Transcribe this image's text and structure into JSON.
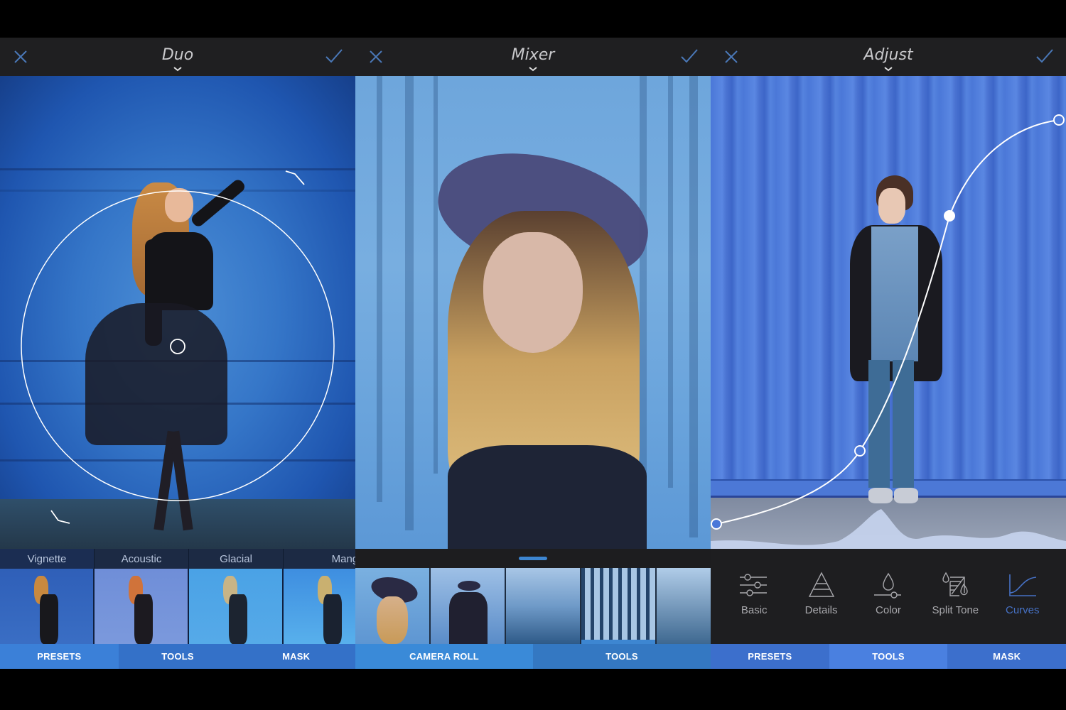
{
  "panels": [
    {
      "id": "duo",
      "header": {
        "title": "Duo",
        "close_icon": "close-icon",
        "confirm_icon": "checkmark-icon",
        "menu_icon": "chevron-down-icon"
      },
      "presets": [
        {
          "label": "Vignette"
        },
        {
          "label": "Acoustic"
        },
        {
          "label": "Glacial"
        },
        {
          "label": "Mangata"
        }
      ],
      "tabs": [
        {
          "label": "PRESETS",
          "active": true
        },
        {
          "label": "TOOLS",
          "active": false
        },
        {
          "label": "MASK",
          "active": false
        }
      ],
      "colors": {
        "tab_active": "#3b80d8",
        "tab_inactive": "#3471c8"
      }
    },
    {
      "id": "mixer",
      "header": {
        "title": "Mixer",
        "close_icon": "close-icon",
        "confirm_icon": "checkmark-icon",
        "menu_icon": "chevron-down-icon"
      },
      "thumbnails": [
        {
          "name": "woman-with-hat-portrait",
          "selected": false
        },
        {
          "name": "woman-with-hat-full",
          "selected": false
        },
        {
          "name": "misty-mountain-forest",
          "selected": false
        },
        {
          "name": "forest-trunks",
          "selected": true
        },
        {
          "name": "snowy-pines",
          "selected": false
        }
      ],
      "tabs": [
        {
          "label": "CAMERA ROLL",
          "active": true
        },
        {
          "label": "TOOLS",
          "active": false
        }
      ],
      "colors": {
        "tab_active": "#3a8ad8",
        "tab_inactive": "#3478c2",
        "handle": "#3d86d1"
      }
    },
    {
      "id": "adjust",
      "header": {
        "title": "Adjust",
        "close_icon": "close-icon",
        "confirm_icon": "checkmark-icon",
        "menu_icon": "chevron-down-icon"
      },
      "tools": [
        {
          "label": "Basic",
          "icon": "sliders-icon",
          "active": false
        },
        {
          "label": "Details",
          "icon": "pyramid-icon",
          "active": false
        },
        {
          "label": "Color",
          "icon": "drop-slider-icon",
          "active": false
        },
        {
          "label": "Split Tone",
          "icon": "split-tone-icon",
          "active": false
        },
        {
          "label": "Curves",
          "icon": "curves-icon",
          "active": true
        }
      ],
      "tabs": [
        {
          "label": "PRESETS",
          "active": false
        },
        {
          "label": "TOOLS",
          "active": true
        },
        {
          "label": "MASK",
          "active": false
        }
      ],
      "colors": {
        "tab_active": "#4a80e0",
        "tab_inactive": "#3c6fcc",
        "active_tool": "#4671c4"
      }
    }
  ],
  "colors": {
    "header_bg": "#1f1f21",
    "accent_icon": "#4a78b8"
  }
}
